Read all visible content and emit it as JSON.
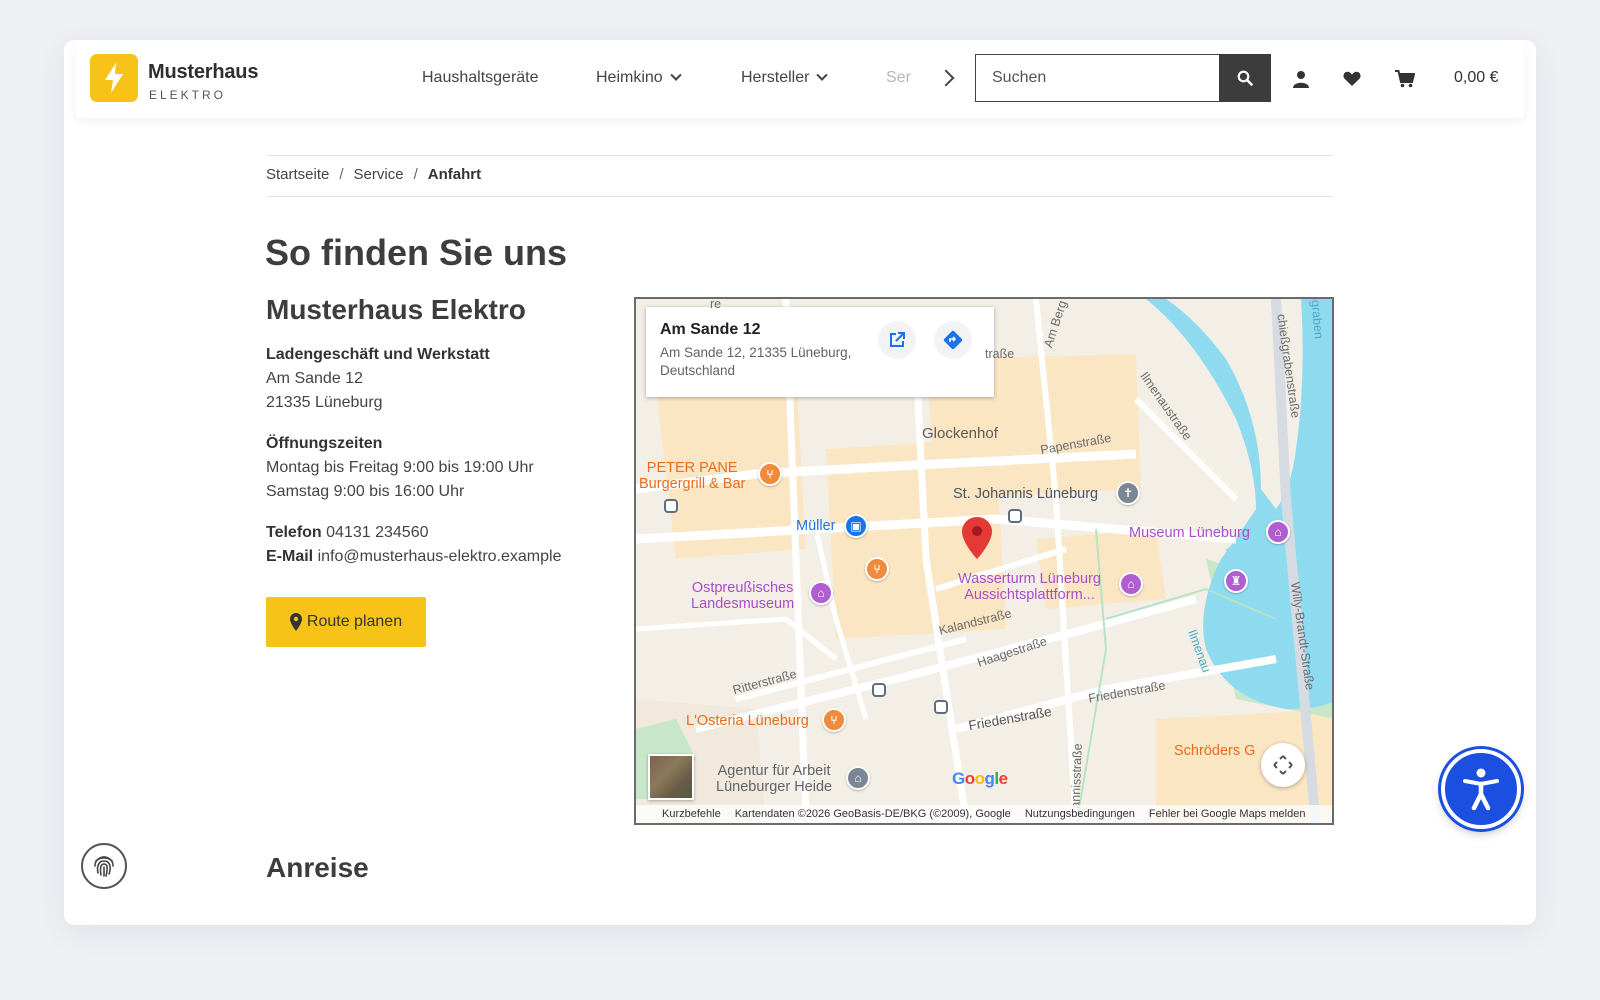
{
  "brand": {
    "name": "Musterhaus",
    "sub": "ELEKTRO",
    "accent": "#f7c318"
  },
  "nav": {
    "items": [
      {
        "label": "Haushaltsgeräte",
        "dropdown": false
      },
      {
        "label": "Heimkino",
        "dropdown": true
      },
      {
        "label": "Hersteller",
        "dropdown": true
      },
      {
        "label": "Ser",
        "dropdown": false
      }
    ]
  },
  "search": {
    "placeholder": "Suchen",
    "icon": "search-icon"
  },
  "header_icons": [
    "user-icon",
    "heart-icon",
    "cart-icon"
  ],
  "cart": {
    "total": "0,00 €"
  },
  "breadcrumb": {
    "items": [
      "Startseite",
      "Service",
      "Anfahrt"
    ],
    "separator": "/"
  },
  "page": {
    "title": "So finden Sie uns",
    "company": "Musterhaus Elektro",
    "store_heading": "Ladengeschäft und Werkstatt",
    "street": "Am Sande 12",
    "city": "21335 Lüneburg",
    "hours_heading": "Öffnungszeiten",
    "hours_weekdays": "Montag bis Freitag 9:00 bis 19:00 Uhr",
    "hours_saturday": "Samstag 9:00 bis 16:00 Uhr",
    "phone_label": "Telefon",
    "phone": "04131 234560",
    "email_label": "E-Mail",
    "email": "info@musterhaus-elektro.example",
    "route_button": "Route planen",
    "section_anreise": "Anreise"
  },
  "map": {
    "card_title": "Am Sande 12",
    "card_address": "Am Sande 12, 21335 Lüneburg, Deutschland",
    "labels": {
      "glockenhof": "Glockenhof",
      "peter_pane": "PETER PANE\nBurgergrill & Bar",
      "mueller": "Müller",
      "johannis": "St. Johannis Lüneburg",
      "museum": "Museum Lüneburg",
      "ostpreussisch": "Ostpreußisches\nLandesmuseum",
      "wasserturm": "Wasserturm Lüneburg\nAussichtsplattform...",
      "osteria": "L'Osteria Lüneburg",
      "agentur": "Agentur für Arbeit\nLüneburger Heide",
      "schroeders": "Schröders G"
    },
    "streets": {
      "papenstrasse": "Papenstraße",
      "kalandstrasse": "Kalandstraße",
      "haagestrasse": "Haagestraße",
      "ritterstrasse": "Ritterstraße",
      "friedenstrasse": "Friedenstraße",
      "friedenstrasse2": "Friedenstraße",
      "ilmenau": "Ilmenau",
      "ilmenaustrasse": "Ilmenaustraße",
      "willy": "Willy-Brandt-Straße",
      "schiessgraben": "chießgrabenstraße",
      "am_berg": "Am Berg",
      "strasse_top": "traße",
      "johannis_str": "annisstraße",
      "graben": "egraben",
      "re_top": "re"
    },
    "google": "Google",
    "attribution": [
      "Kurzbefehle",
      "Kartendaten ©2026 GeoBasis-DE/BKG (©2009), Google",
      "Nutzungsbedingungen",
      "Fehler bei Google Maps melden"
    ]
  },
  "floating": {
    "fingerprint": "fingerprint-icon",
    "accessibility": "accessibility-icon"
  }
}
